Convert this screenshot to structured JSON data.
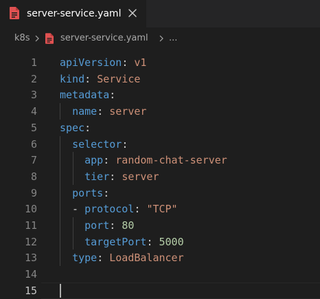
{
  "tab": {
    "filename": "server-service.yaml",
    "file_icon": "yaml-file-icon",
    "close_icon": "close-icon",
    "accent_color": "#e05151"
  },
  "breadcrumb": {
    "folder": "k8s",
    "file": "server-service.yaml",
    "more": "..."
  },
  "editor": {
    "active_line": 15,
    "lines": [
      {
        "num": "1",
        "tokens": [
          {
            "t": "apiVersion",
            "c": "key"
          },
          {
            "t": ": ",
            "c": "punct"
          },
          {
            "t": "v1",
            "c": "val"
          }
        ]
      },
      {
        "num": "2",
        "tokens": [
          {
            "t": "kind",
            "c": "key"
          },
          {
            "t": ": ",
            "c": "punct"
          },
          {
            "t": "Service",
            "c": "val"
          }
        ]
      },
      {
        "num": "3",
        "tokens": [
          {
            "t": "metadata",
            "c": "key"
          },
          {
            "t": ":",
            "c": "punct"
          }
        ]
      },
      {
        "num": "4",
        "tokens": [
          {
            "t": "  ",
            "c": "punct"
          },
          {
            "t": "name",
            "c": "key"
          },
          {
            "t": ": ",
            "c": "punct"
          },
          {
            "t": "server",
            "c": "val"
          }
        ]
      },
      {
        "num": "5",
        "tokens": [
          {
            "t": "spec",
            "c": "key"
          },
          {
            "t": ":",
            "c": "punct"
          }
        ]
      },
      {
        "num": "6",
        "tokens": [
          {
            "t": "  ",
            "c": "punct"
          },
          {
            "t": "selector",
            "c": "key"
          },
          {
            "t": ":",
            "c": "punct"
          }
        ]
      },
      {
        "num": "7",
        "tokens": [
          {
            "t": "    ",
            "c": "punct"
          },
          {
            "t": "app",
            "c": "key"
          },
          {
            "t": ": ",
            "c": "punct"
          },
          {
            "t": "random-chat-server",
            "c": "val"
          }
        ]
      },
      {
        "num": "8",
        "tokens": [
          {
            "t": "    ",
            "c": "punct"
          },
          {
            "t": "tier",
            "c": "key"
          },
          {
            "t": ": ",
            "c": "punct"
          },
          {
            "t": "server",
            "c": "val"
          }
        ]
      },
      {
        "num": "9",
        "tokens": [
          {
            "t": "  ",
            "c": "punct"
          },
          {
            "t": "ports",
            "c": "key"
          },
          {
            "t": ":",
            "c": "punct"
          }
        ]
      },
      {
        "num": "10",
        "tokens": [
          {
            "t": "  - ",
            "c": "punct"
          },
          {
            "t": "protocol",
            "c": "key"
          },
          {
            "t": ": ",
            "c": "punct"
          },
          {
            "t": "\"TCP\"",
            "c": "val"
          }
        ]
      },
      {
        "num": "11",
        "tokens": [
          {
            "t": "    ",
            "c": "punct"
          },
          {
            "t": "port",
            "c": "key"
          },
          {
            "t": ": ",
            "c": "punct"
          },
          {
            "t": "80",
            "c": "num"
          }
        ]
      },
      {
        "num": "12",
        "tokens": [
          {
            "t": "    ",
            "c": "punct"
          },
          {
            "t": "targetPort",
            "c": "key"
          },
          {
            "t": ": ",
            "c": "punct"
          },
          {
            "t": "5000",
            "c": "num"
          }
        ]
      },
      {
        "num": "13",
        "tokens": [
          {
            "t": "  ",
            "c": "punct"
          },
          {
            "t": "type",
            "c": "key"
          },
          {
            "t": ": ",
            "c": "punct"
          },
          {
            "t": "LoadBalancer",
            "c": "val"
          }
        ]
      },
      {
        "num": "14",
        "tokens": []
      },
      {
        "num": "15",
        "tokens": []
      }
    ]
  },
  "colors": {
    "key": "#569cd6",
    "string": "#ce9178",
    "number": "#b5cea8",
    "punctuation": "#d4d4d4",
    "line_number": "#858585",
    "background": "#1e1e1e"
  }
}
